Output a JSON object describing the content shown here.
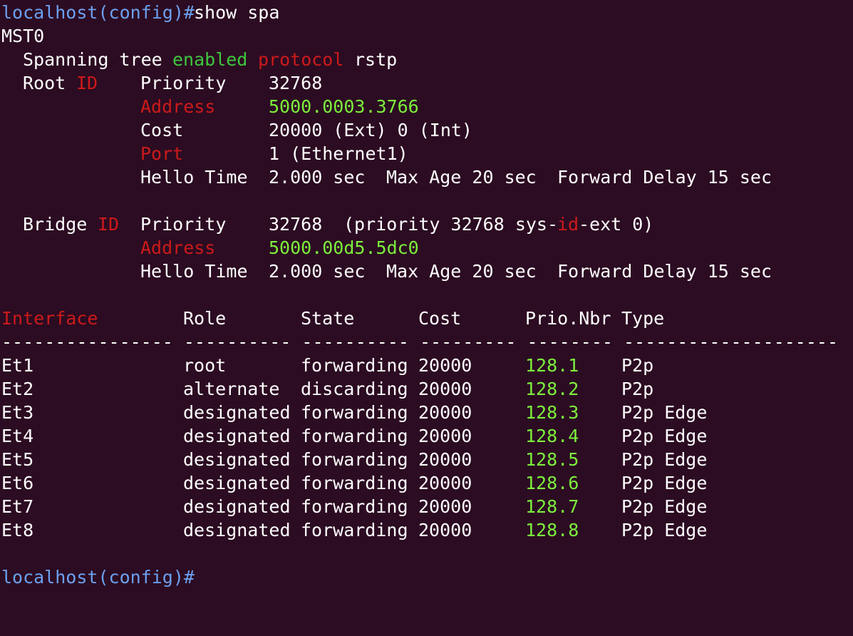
{
  "terminal": {
    "prompt_host": "localhost(config)#",
    "command": "show spa",
    "instance": "MST0",
    "spanning_tree": {
      "prefix": "Spanning tree",
      "status": "enabled",
      "protocol_label": "protocol",
      "protocol": "rstp"
    },
    "root": {
      "label": "Root",
      "id_label": "ID",
      "priority_label": "Priority",
      "priority": "32768",
      "address_label": "Address",
      "address": "5000.0003.3766",
      "cost_label": "Cost",
      "cost": "20000 (Ext) 0 (Int)",
      "port_label": "Port",
      "port": "1 (Ethernet1)",
      "hello_label": "Hello Time",
      "hello": "2.000 sec",
      "max_age": "Max Age 20 sec",
      "forward_delay": "Forward Delay 15 sec"
    },
    "bridge": {
      "label": "Bridge",
      "id_label": "ID",
      "priority_label": "Priority",
      "priority": "32768",
      "priority_detail_pre": "(priority 32768 sys-",
      "priority_detail_id": "id",
      "priority_detail_post": "-ext 0)",
      "address_label": "Address",
      "address": "5000.00d5.5dc0",
      "hello_label": "Hello Time",
      "hello": "2.000 sec",
      "max_age": "Max Age 20 sec",
      "forward_delay": "Forward Delay 15 sec"
    },
    "table": {
      "headers": {
        "interface": "Interface",
        "role": "Role",
        "state": "State",
        "cost": "Cost",
        "prio": "Prio.Nbr",
        "type": "Type"
      },
      "separator": "---------------- ---------- ---------- --------- -------- --------------------",
      "rows": [
        {
          "interface": "Et1",
          "role": "root",
          "state": "forwarding",
          "cost": "20000",
          "prio": "128.1",
          "type": "P2p"
        },
        {
          "interface": "Et2",
          "role": "alternate",
          "state": "discarding",
          "cost": "20000",
          "prio": "128.2",
          "type": "P2p"
        },
        {
          "interface": "Et3",
          "role": "designated",
          "state": "forwarding",
          "cost": "20000",
          "prio": "128.3",
          "type": "P2p Edge"
        },
        {
          "interface": "Et4",
          "role": "designated",
          "state": "forwarding",
          "cost": "20000",
          "prio": "128.4",
          "type": "P2p Edge"
        },
        {
          "interface": "Et5",
          "role": "designated",
          "state": "forwarding",
          "cost": "20000",
          "prio": "128.5",
          "type": "P2p Edge"
        },
        {
          "interface": "Et6",
          "role": "designated",
          "state": "forwarding",
          "cost": "20000",
          "prio": "128.6",
          "type": "P2p Edge"
        },
        {
          "interface": "Et7",
          "role": "designated",
          "state": "forwarding",
          "cost": "20000",
          "prio": "128.7",
          "type": "P2p Edge"
        },
        {
          "interface": "Et8",
          "role": "designated",
          "state": "forwarding",
          "cost": "20000",
          "prio": "128.8",
          "type": "P2p Edge"
        }
      ]
    },
    "final_prompt": "localhost(config)#"
  }
}
